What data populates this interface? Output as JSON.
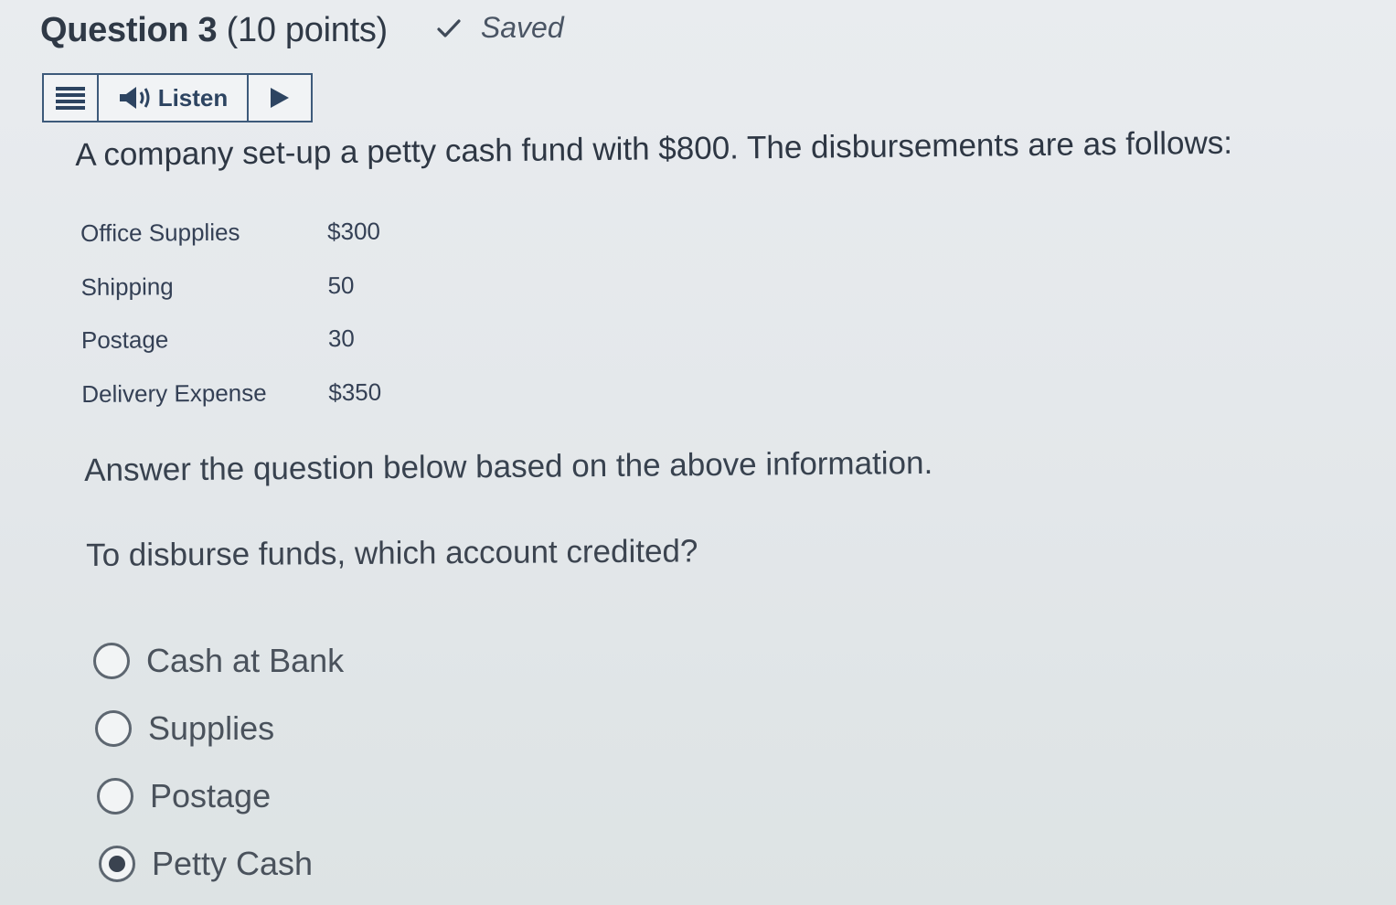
{
  "header": {
    "question_number": "Question 3",
    "points": "(10 points)",
    "status": "Saved"
  },
  "listen_bar": {
    "listen_label": "Listen"
  },
  "prompt": "A company set-up a petty cash fund with $800. The disbursements are as follows:",
  "disbursements": [
    {
      "label": "Office Supplies",
      "amount": "$300"
    },
    {
      "label": "Shipping",
      "amount": "50"
    },
    {
      "label": "Postage",
      "amount": "30"
    },
    {
      "label": "Delivery Expense",
      "amount": "$350"
    }
  ],
  "instruction": "Answer the question below based on the above information.",
  "question": "To disburse funds, which account credited?",
  "options": [
    {
      "label": "Cash at Bank",
      "selected": false
    },
    {
      "label": "Supplies",
      "selected": false
    },
    {
      "label": "Postage",
      "selected": false
    },
    {
      "label": "Petty Cash",
      "selected": true
    }
  ]
}
